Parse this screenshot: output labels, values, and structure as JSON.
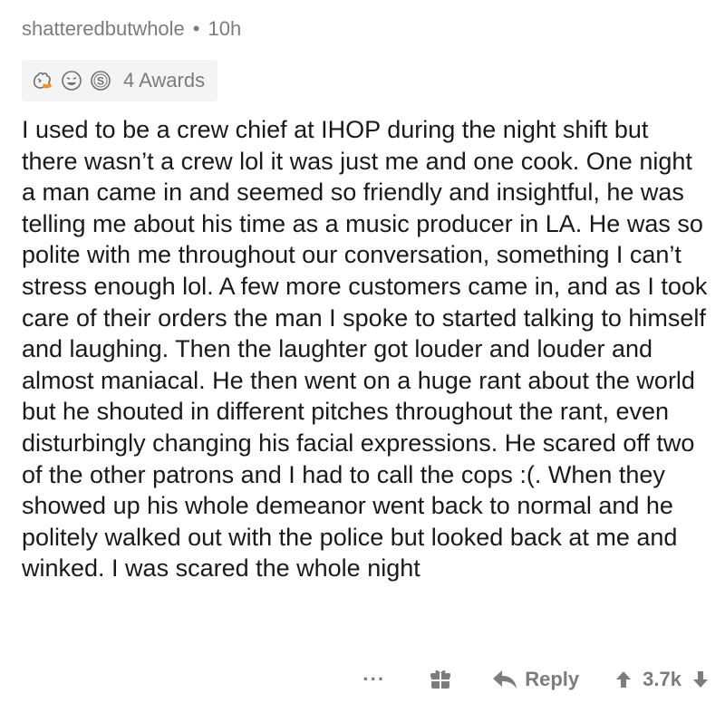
{
  "comment": {
    "author": "shatteredbutwhole",
    "separator": "•",
    "age": "10h",
    "awards": {
      "icons": [
        "wholesome-seal-icon",
        "laughing-face-icon",
        "silver-s-icon"
      ],
      "label": "4 Awards"
    },
    "body": "I used to be a crew chief at IHOP during the night shift but there wasn’t a crew lol it was just me and one cook. One night a man came in and seemed so friendly and insightful, he was telling me about his time as a music producer in LA. He was so polite with me throughout our conversation, something I can’t stress enough lol. A few more customers came in, and as I took care of their orders the man I spoke to started talking to himself and laughing. Then the laughter got louder and louder and almost maniacal. He then went on a huge rant about the world but he shouted in different pitches throughout the rant, even disturbingly changing his facial expressions. He scared off two of the other patrons and I had to call the cops :(. When they showed up his whole demeanor went back to normal and he politely walked out with the police but looked back at me and winked. I was scared the whole night"
  },
  "actions": {
    "more_label": "···",
    "reply_label": "Reply",
    "score": "3.7k"
  },
  "colors": {
    "muted": "#7c7c7c",
    "text": "#1a1a1b",
    "pill_bg": "#f4f4f4",
    "award_orange": "#f08c2a"
  }
}
